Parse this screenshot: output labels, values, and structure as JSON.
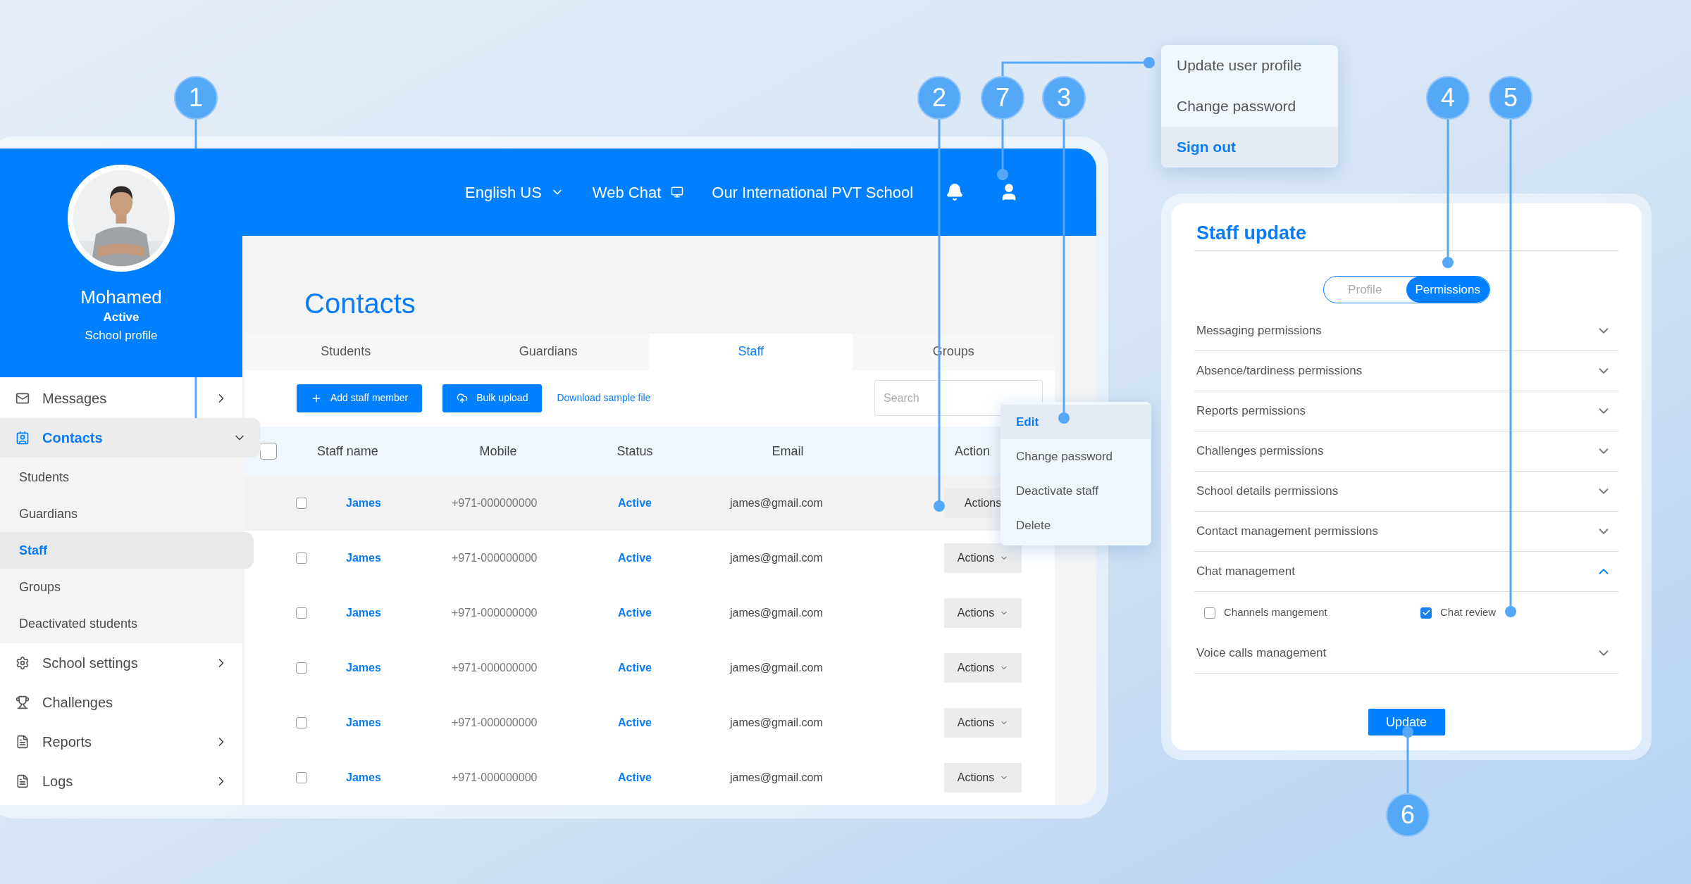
{
  "sidebar": {
    "profile": {
      "name": "Mohamed",
      "status": "Active",
      "role": "School profile"
    },
    "items": [
      {
        "label": "Messages",
        "has_submenu": true,
        "expanded": false,
        "selected": false
      },
      {
        "label": "Contacts",
        "has_submenu": true,
        "expanded": true,
        "selected": true,
        "children": [
          {
            "label": "Students",
            "selected": false
          },
          {
            "label": "Guardians",
            "selected": false
          },
          {
            "label": "Staff",
            "selected": true
          },
          {
            "label": "Groups",
            "selected": false
          },
          {
            "label": "Deactivated students",
            "selected": false
          }
        ]
      },
      {
        "label": "School settings",
        "has_submenu": true,
        "expanded": false,
        "selected": false
      },
      {
        "label": "Challenges",
        "has_submenu": false,
        "expanded": false,
        "selected": false
      },
      {
        "label": "Reports",
        "has_submenu": true,
        "expanded": false,
        "selected": false
      },
      {
        "label": "Logs",
        "has_submenu": true,
        "expanded": false,
        "selected": false
      }
    ]
  },
  "header": {
    "language": "English US",
    "web_chat": "Web Chat",
    "school": "Our International PVT School"
  },
  "page": {
    "title": "Contacts",
    "tabs": [
      {
        "label": "Students",
        "selected": false
      },
      {
        "label": "Guardians",
        "selected": false
      },
      {
        "label": "Staff",
        "selected": true
      },
      {
        "label": "Groups",
        "selected": false
      }
    ],
    "add_button": "Add staff member",
    "upload_button": "Bulk upload",
    "download_link": "Download sample file",
    "search": {
      "placeholder": "Search"
    },
    "table": {
      "all_checked": false,
      "columns": [
        "Staff name",
        "Mobile",
        "Status",
        "Email",
        "Action"
      ],
      "rows": [
        {
          "name": "James",
          "mobile": "+971-000000000",
          "status": "Active",
          "email": "james@gmail.com",
          "action": "Actions",
          "checked": false,
          "selected": true
        },
        {
          "name": "James",
          "mobile": "+971-000000000",
          "status": "Active",
          "email": "james@gmail.com",
          "action": "Actions",
          "checked": false,
          "selected": false
        },
        {
          "name": "James",
          "mobile": "+971-000000000",
          "status": "Active",
          "email": "james@gmail.com",
          "action": "Actions",
          "checked": false,
          "selected": false
        },
        {
          "name": "James",
          "mobile": "+971-000000000",
          "status": "Active",
          "email": "james@gmail.com",
          "action": "Actions",
          "checked": false,
          "selected": false
        },
        {
          "name": "James",
          "mobile": "+971-000000000",
          "status": "Active",
          "email": "james@gmail.com",
          "action": "Actions",
          "checked": false,
          "selected": false
        },
        {
          "name": "James",
          "mobile": "+971-000000000",
          "status": "Active",
          "email": "james@gmail.com",
          "action": "Actions",
          "checked": false,
          "selected": false
        }
      ]
    }
  },
  "action_menu": {
    "items": [
      {
        "label": "Edit",
        "selected": true
      },
      {
        "label": "Change password",
        "selected": false
      },
      {
        "label": "Deactivate staff",
        "selected": false
      },
      {
        "label": "Delete",
        "selected": false
      }
    ]
  },
  "user_menu": {
    "items": [
      {
        "label": "Update user profile",
        "selected": false
      },
      {
        "label": "Change password",
        "selected": false
      },
      {
        "label": "Sign out",
        "selected": true
      }
    ]
  },
  "staff_update": {
    "title": "Staff update",
    "toggle": [
      {
        "label": "Profile",
        "selected": false
      },
      {
        "label": "Permissions",
        "selected": true
      }
    ],
    "sections": [
      {
        "label": "Messaging permissions",
        "expanded": false
      },
      {
        "label": "Absence/tardiness permissions",
        "expanded": false
      },
      {
        "label": "Reports permissions",
        "expanded": false
      },
      {
        "label": "Challenges permissions",
        "expanded": false
      },
      {
        "label": "School details permissions",
        "expanded": false
      },
      {
        "label": "Contact management permissions",
        "expanded": false
      },
      {
        "label": "Chat management",
        "expanded": true,
        "options": [
          {
            "label": "Channels mangement",
            "checked": false
          },
          {
            "label": "Chat review",
            "checked": true
          }
        ]
      },
      {
        "label": "Voice calls management",
        "expanded": false
      }
    ],
    "button": "Update"
  },
  "callouts": [
    "1",
    "2",
    "7",
    "3",
    "4",
    "5",
    "6"
  ]
}
